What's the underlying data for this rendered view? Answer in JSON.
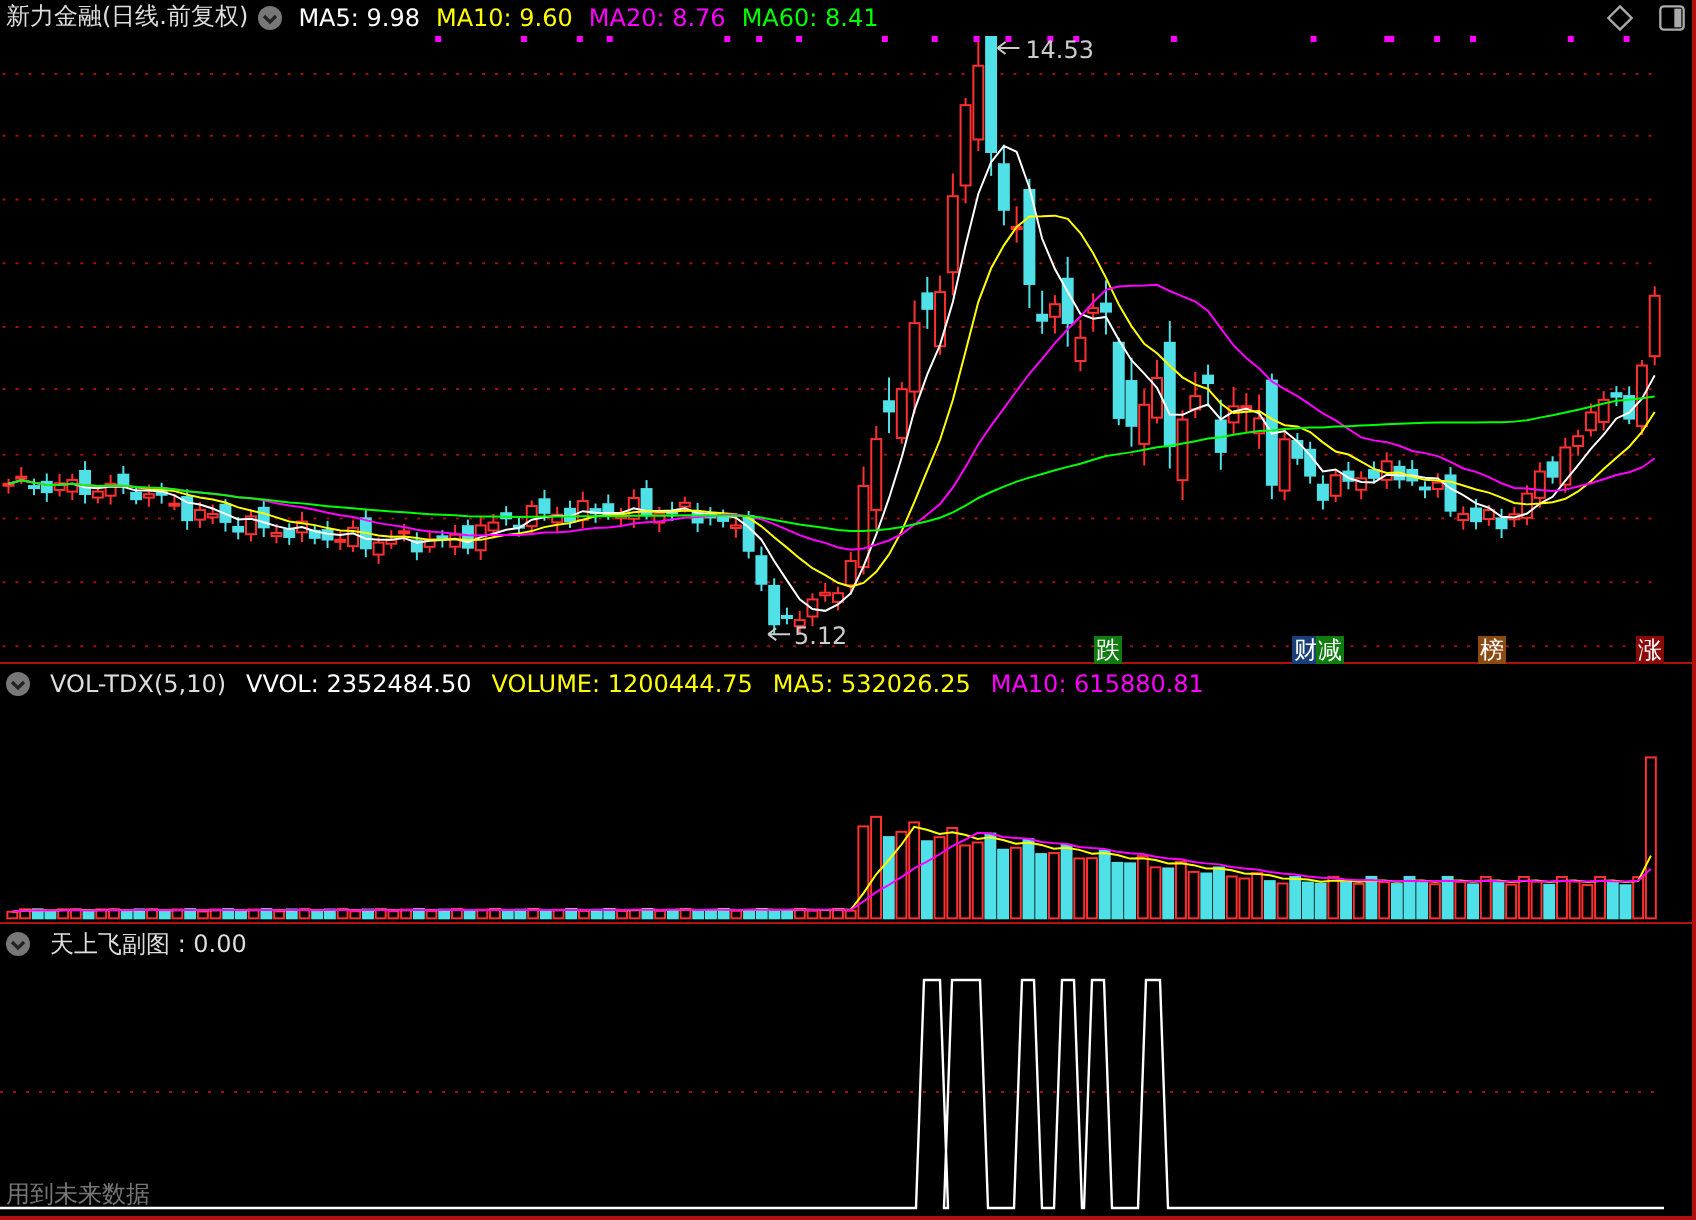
{
  "header": {
    "title": "新力金融(日线.前复权)",
    "ma_labels": [
      {
        "text": "MA5: 9.98",
        "color": "#ffffff"
      },
      {
        "text": "MA10: 9.60",
        "color": "#ffff00"
      },
      {
        "text": "MA20: 8.76",
        "color": "#ff00ff"
      },
      {
        "text": "MA60: 8.41",
        "color": "#00ff00"
      }
    ]
  },
  "price_labels": [
    {
      "kind": "high",
      "text": "14.53"
    },
    {
      "kind": "low",
      "text": "5.12"
    }
  ],
  "signals": [
    {
      "text": "跌",
      "color": "#107c10"
    },
    {
      "text": "财",
      "color": "#1a3f78"
    },
    {
      "text": "减",
      "color": "#107c10"
    },
    {
      "text": "榜",
      "color": "#8a4a12"
    },
    {
      "text": "涨",
      "color": "#8a0a0a"
    }
  ],
  "volume_panel": {
    "title": "VOL-TDX(5,10)",
    "labels": [
      {
        "text": "VVOL: 2352484.50",
        "color": "#ffffff"
      },
      {
        "text": "VOLUME: 1200444.75",
        "color": "#ffff00"
      },
      {
        "text": "MA5: 532026.25",
        "color": "#ffff00"
      },
      {
        "text": "MA10: 615880.81",
        "color": "#ff00ff"
      }
    ]
  },
  "indicator_panel": {
    "title": "天上飞副图 : 0.00",
    "note": "用到未来数据"
  }
}
